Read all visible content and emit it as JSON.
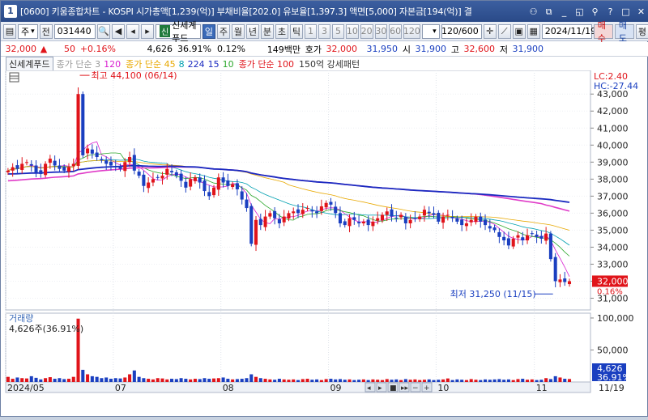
{
  "window": {
    "number": "1",
    "title": "[0600] 키움종합차트 - KOSPI 시가총액[1,239(억)] 부채비율[202.0] 유보율[1,397.3] 액면[5,000] 자본금[194(억)] 결",
    "buttons": [
      "link-icon",
      "restore-icon",
      "minimize-icon",
      "tile-icon",
      "pin-icon",
      "help-icon",
      "window-icon",
      "close-icon"
    ]
  },
  "toolbar": {
    "menu_btn": "▤",
    "market": "주",
    "market_arrow": "▾",
    "type_label": "전",
    "code": "031440",
    "credit_badge": "신",
    "stock_name": "신세계푸드",
    "periods": [
      "일",
      "주",
      "월",
      "년",
      "분",
      "초",
      "틱"
    ],
    "selected_period": "일",
    "intervals": [
      "1",
      "3",
      "5",
      "10",
      "20",
      "30",
      "60",
      "120"
    ],
    "count": "120",
    "count_total": "/600",
    "date": "2024/11/19",
    "buy_label": "매수",
    "sell_label": "매도",
    "eval_label": "평"
  },
  "quote": {
    "price": "32,000",
    "arrow": "▲",
    "change": "50",
    "change_pct": "+0.16%",
    "volume": "4,626",
    "vol_ratio": "36.91%",
    "turnover": "0.12%",
    "amount": "149백만",
    "ask_label": "호가",
    "ask_price": "32,000",
    "bid_price": "31,950",
    "open_label": "시",
    "open": "31,900",
    "high_label": "고",
    "high": "32,600",
    "low_label": "저",
    "low": "31,900"
  },
  "legend": {
    "name": "신세계푸드",
    "ma_short_label": "종가 단순 3",
    "ma_short_120": "120",
    "ma_mid_label": "종가 단순 45",
    "ma_mid_vals": [
      "8",
      "224",
      "15",
      "10"
    ],
    "ma_long_label": "종가 단순 100",
    "pattern": "150억 강세패턴"
  },
  "chart_data": {
    "type": "candlestick",
    "price_axis": [
      "43,000",
      "42,000",
      "41,000",
      "40,000",
      "39,000",
      "38,000",
      "37,000",
      "36,000",
      "35,000",
      "34,000",
      "33,000",
      "32,000",
      "31,000"
    ],
    "ylim": [
      30500,
      44200
    ],
    "lc_label": "LC:2.40",
    "hc_label": "HC:-27.44",
    "high_marker": "최고 44,100 (06/14)",
    "low_marker": "최저 31,250 (11/15)",
    "current_price": "32,000",
    "current_pct": "0.16%",
    "volume_title": "거래량",
    "volume_value": "4,626주(36.91%)",
    "volume_axis": [
      "100,000",
      "50,000"
    ],
    "volume_current": "4,626",
    "volume_current_pct": "36.91%",
    "x_labels": [
      "2024/05",
      "07",
      "08",
      "09",
      "10",
      "11",
      "11/19"
    ],
    "closes": [
      38500,
      38700,
      38600,
      38900,
      39000,
      38800,
      38400,
      38300,
      38900,
      39200,
      38800,
      38600,
      38500,
      38700,
      38900,
      43000,
      39400,
      39800,
      39500,
      39300,
      39100,
      38900,
      38800,
      38700,
      38600,
      39000,
      39300,
      38500,
      38200,
      37600,
      37800,
      38000,
      38100,
      38200,
      38600,
      38400,
      38200,
      37900,
      37500,
      38000,
      38100,
      37800,
      37300,
      37000,
      37500,
      38100,
      37800,
      37600,
      37700,
      37400,
      36800,
      36300,
      34200,
      35600,
      35300,
      35800,
      36000,
      35700,
      35400,
      35800,
      36000,
      36100,
      36000,
      36200,
      36300,
      36100,
      36000,
      36400,
      36600,
      36500,
      36000,
      35400,
      35300,
      35700,
      35600,
      35400,
      35500,
      35300,
      35500,
      35700,
      35900,
      36100,
      35800,
      35700,
      35900,
      35400,
      35600,
      35700,
      35800,
      36200,
      36000,
      35900,
      35500,
      35800,
      35900,
      35700,
      35500,
      35300,
      35400,
      35600,
      35800,
      35500,
      35300,
      35100,
      35000,
      34600,
      34400,
      34100,
      34500,
      34700,
      34400,
      34700,
      34800,
      34600,
      34500,
      34800,
      33300,
      32000,
      32100,
      31950,
      32000
    ],
    "volumes": [
      8000,
      5000,
      7000,
      6000,
      5500,
      9000,
      6500,
      4000,
      6000,
      7500,
      5000,
      6000,
      4500,
      5000,
      8000,
      99000,
      19000,
      12000,
      9000,
      8000,
      6000,
      7000,
      5000,
      6000,
      5500,
      7000,
      12000,
      18000,
      8000,
      6000,
      5000,
      4000,
      6000,
      5500,
      4000,
      5000,
      4500,
      6000,
      5000,
      4000,
      5000,
      4500,
      6000,
      5000,
      5500,
      6000,
      7000,
      5000,
      4000,
      4500,
      5000,
      6000,
      12000,
      8000,
      6000,
      5000,
      4000,
      3500,
      5000,
      4000,
      3500,
      4000,
      3000,
      4500,
      5000,
      3500,
      4000,
      3000,
      4500,
      5000,
      4000,
      4500,
      3500,
      4000,
      3000,
      3500,
      4000,
      3000,
      4000,
      3500,
      3000,
      4500,
      3500,
      4000,
      3000,
      4500,
      3500,
      4000,
      3000,
      3500,
      4000,
      3000,
      3500,
      4000,
      5500,
      3000,
      4000,
      3500,
      3000,
      4500,
      3500,
      3000,
      4000,
      3500,
      4000,
      4500,
      3500,
      4000,
      3000,
      4500,
      5000,
      3500,
      4000,
      3000,
      3500,
      6000,
      4500,
      9000,
      7000,
      5000,
      4626
    ]
  }
}
